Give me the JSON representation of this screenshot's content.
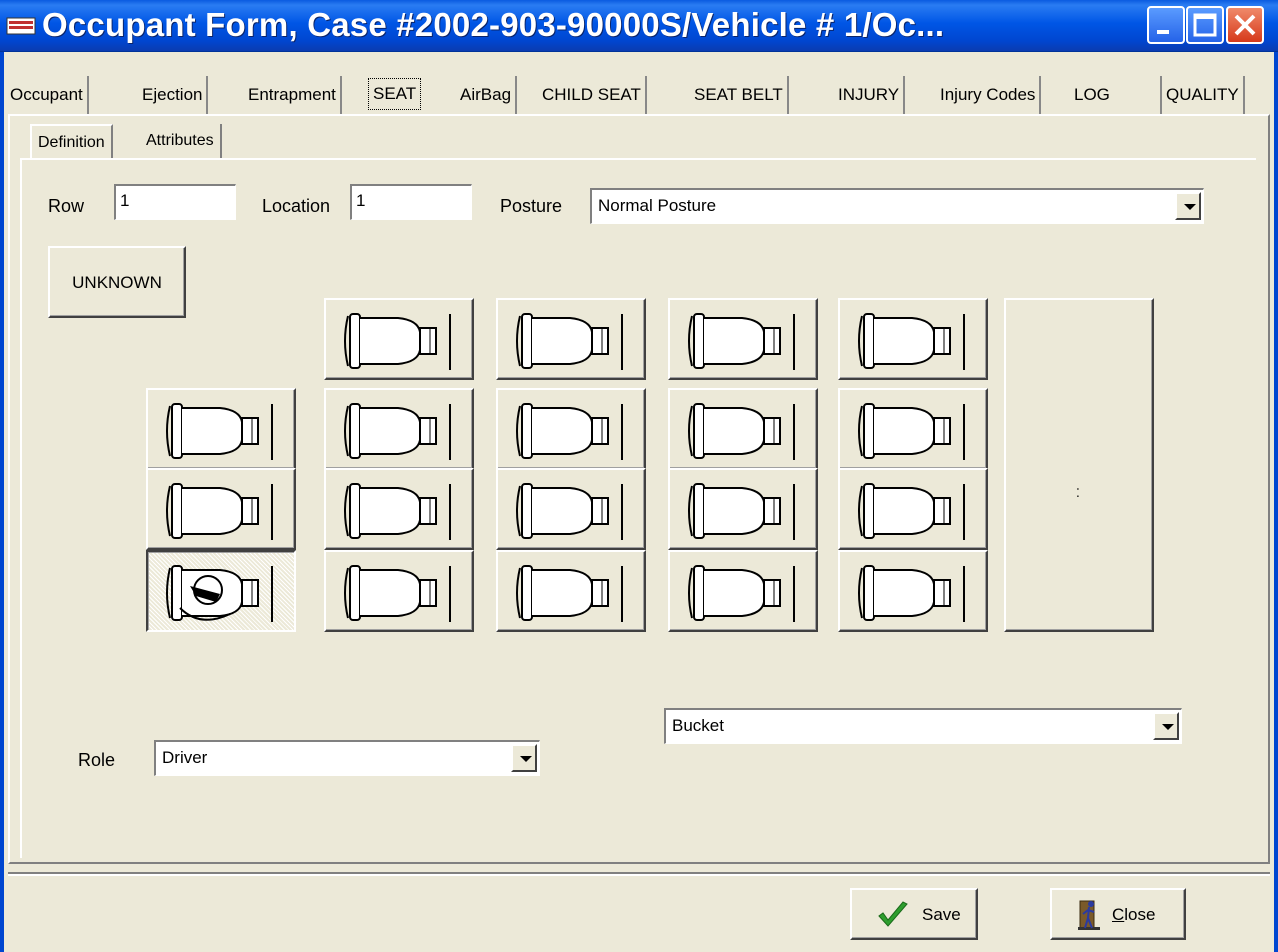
{
  "window": {
    "title": "Occupant Form, Case #2002-903-90000S/Vehicle # 1/Oc..."
  },
  "main_tabs": [
    {
      "label": "Occupant"
    },
    {
      "label": "Ejection"
    },
    {
      "label": "Entrapment"
    },
    {
      "label": "SEAT",
      "selected": true
    },
    {
      "label": "AirBag"
    },
    {
      "label": "CHILD SEAT"
    },
    {
      "label": "SEAT BELT"
    },
    {
      "label": "INJURY"
    },
    {
      "label": "Injury Codes"
    },
    {
      "label": "LOG"
    },
    {
      "label": "QUALITY"
    }
  ],
  "sub_tabs": [
    {
      "label": "Definition",
      "selected": true
    },
    {
      "label": "Attributes"
    }
  ],
  "fields": {
    "row_label": "Row",
    "row_value": "1",
    "location_label": "Location",
    "location_value": "1",
    "posture_label": "Posture",
    "posture_value": "Normal Posture",
    "role_label": "Role",
    "role_value": "Driver",
    "seat_type_value": "Bucket"
  },
  "unknown_button": "UNKNOWN",
  "seat_grid": {
    "selected_row": 1,
    "selected_location": 1
  },
  "footer": {
    "save_label": "Save",
    "close_label": "Close",
    "close_mnemonic": "C"
  },
  "colors": {
    "titlebar": "#0054e3",
    "face": "#ece9d8",
    "save_check": "#2e9e2e"
  }
}
